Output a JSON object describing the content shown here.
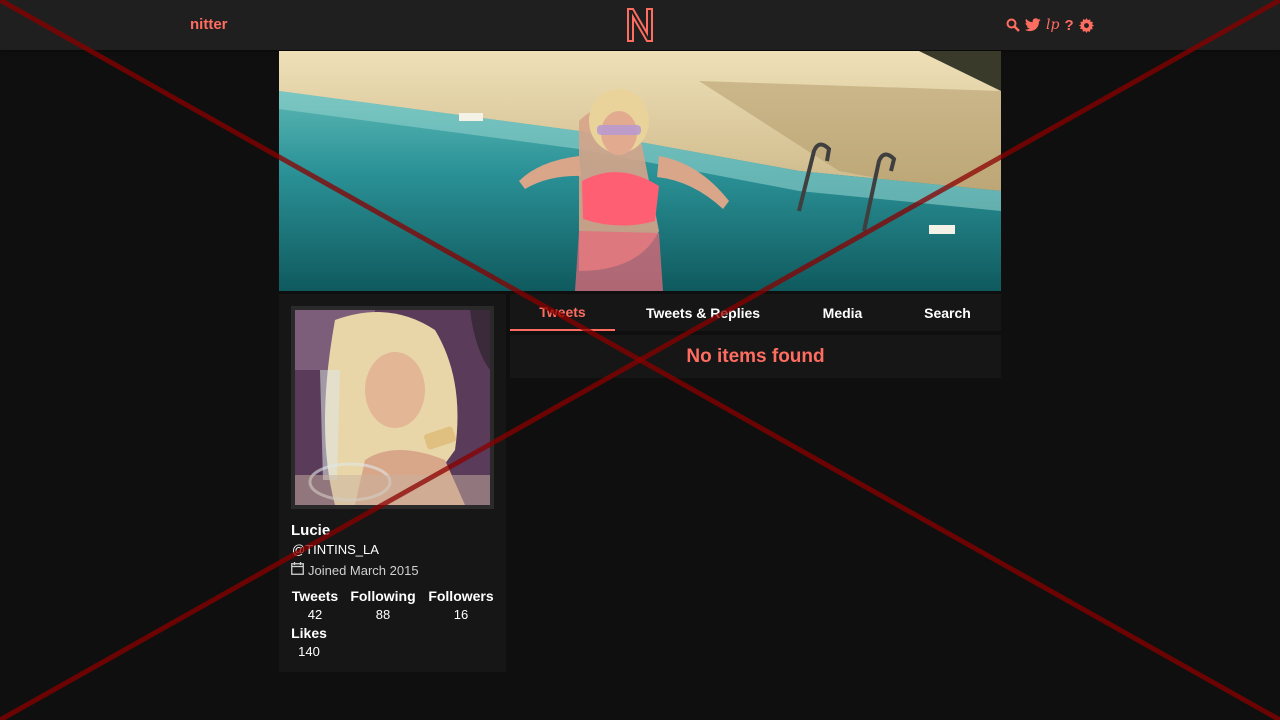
{
  "navbar": {
    "brand": "nitter",
    "logo_letter": "N",
    "icons": [
      "search-icon",
      "twitter-bird-icon",
      "lp-icon",
      "help-icon",
      "gear-icon"
    ],
    "lp_text": "lp",
    "help_text": "?"
  },
  "profile": {
    "fullname": "Lucie",
    "username": "@TINTINS_LA",
    "joined": "Joined March 2015",
    "stats": {
      "tweets_label": "Tweets",
      "tweets": "42",
      "following_label": "Following",
      "following": "88",
      "followers_label": "Followers",
      "followers": "16",
      "likes_label": "Likes",
      "likes": "140"
    }
  },
  "tabs": [
    "Tweets",
    "Tweets & Replies",
    "Media",
    "Search"
  ],
  "active_tab": "Tweets",
  "timeline": {
    "empty_message": "No items found"
  },
  "colors": {
    "accent": "#ff6c60",
    "background": "#0f0f0f",
    "panel": "#161616",
    "navbar": "#1f1f1f"
  }
}
